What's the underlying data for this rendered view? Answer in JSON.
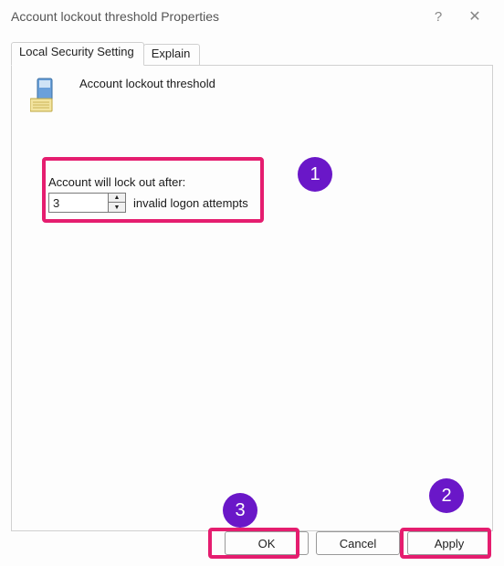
{
  "titlebar": {
    "title": "Account lockout threshold Properties"
  },
  "tabs": {
    "active": {
      "label": "Local Security Setting"
    },
    "second": {
      "label": "Explain"
    }
  },
  "policy": {
    "name": "Account lockout threshold"
  },
  "setting": {
    "label": "Account will lock out after:",
    "value": "3",
    "unit_label": "invalid logon attempts"
  },
  "buttons": {
    "ok": "OK",
    "cancel": "Cancel",
    "apply": "Apply"
  },
  "annotations": {
    "n1": "1",
    "n2": "2",
    "n3": "3"
  }
}
